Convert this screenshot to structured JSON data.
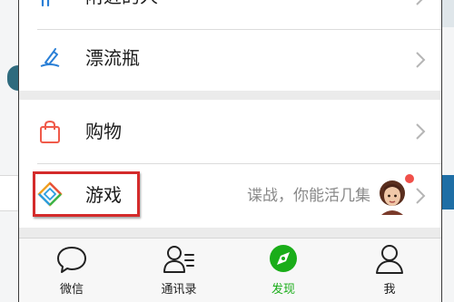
{
  "menu": {
    "nearby_label": "附近的人",
    "bottle_label": "漂流瓶",
    "shopping_label": "购物",
    "games_label": "游戏",
    "games_detail": "谍战，你能活几集"
  },
  "tabbar": {
    "chats_label": "微信",
    "contacts_label": "通讯录",
    "discover_label": "发现",
    "me_label": "我",
    "active_color": "#1aad19"
  },
  "colors": {
    "highlight": "#d42b2b",
    "badge": "#f0504a",
    "bottle_icon": "#2a7fd6",
    "shopping_icon": "#f05a4a"
  },
  "icons": {
    "nearby": "nearby-people-icon",
    "bottle": "drift-bottle-icon",
    "shopping": "shopping-bag-icon",
    "games": "game-diamond-icon",
    "chats": "chat-bubble-icon",
    "contacts": "contacts-icon",
    "discover": "compass-icon",
    "me": "person-icon"
  }
}
